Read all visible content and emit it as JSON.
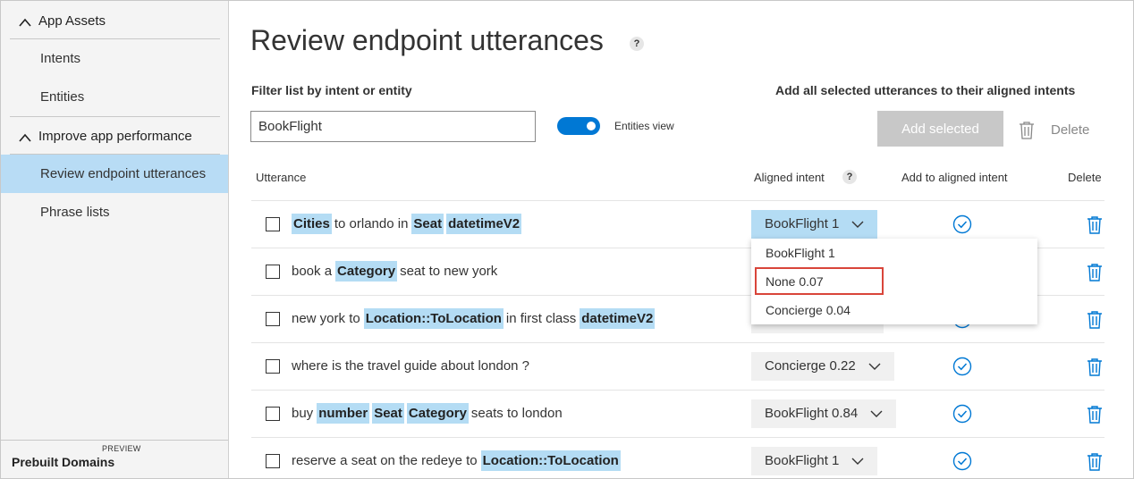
{
  "sidebar": {
    "app_assets": "App Assets",
    "intents": "Intents",
    "entities": "Entities",
    "improve": "Improve app performance",
    "review": "Review endpoint utterances",
    "phrase_lists": "Phrase lists",
    "prebuilt": "Prebuilt Domains",
    "preview_badge": "PREVIEW"
  },
  "main": {
    "title": "Review endpoint utterances",
    "help_glyph": "?",
    "filter_label": "Filter list by intent or entity",
    "filter_value": "BookFlight",
    "entities_view": "Entities view",
    "entities_view_on": true,
    "add_all_label": "Add all selected utterances to their aligned intents",
    "add_selected": "Add selected",
    "delete": "Delete"
  },
  "table": {
    "headers": {
      "utterance": "Utterance",
      "aligned_intent": "Aligned intent",
      "add_to_intent": "Add to aligned intent",
      "delete": "Delete"
    },
    "rows": [
      {
        "tokens": [
          {
            "t": "Cities",
            "e": true
          },
          {
            "t": "to orlando in",
            "e": false
          },
          {
            "t": "Seat",
            "e": true
          },
          {
            "t": "datetimeV2",
            "e": true
          }
        ],
        "intent": "BookFlight 1"
      },
      {
        "tokens": [
          {
            "t": "book a",
            "e": false
          },
          {
            "t": "Category",
            "e": true
          },
          {
            "t": "seat to new york",
            "e": false
          }
        ],
        "intent": ""
      },
      {
        "tokens": [
          {
            "t": "new york to",
            "e": false
          },
          {
            "t": "Location::ToLocation",
            "e": true
          },
          {
            "t": "in first class",
            "e": false
          },
          {
            "t": "datetimeV2",
            "e": true
          }
        ],
        "intent": ""
      },
      {
        "tokens": [
          {
            "t": "where is the travel guide about london ?",
            "e": false
          }
        ],
        "intent": "Concierge 0.22"
      },
      {
        "tokens": [
          {
            "t": "buy",
            "e": false
          },
          {
            "t": "number",
            "e": true
          },
          {
            "t": "Seat",
            "e": true
          },
          {
            "t": "Category",
            "e": true
          },
          {
            "t": "seats to london",
            "e": false
          }
        ],
        "intent": "BookFlight 0.84"
      },
      {
        "tokens": [
          {
            "t": "reserve a seat on the redeye to",
            "e": false
          },
          {
            "t": "Location::ToLocation",
            "e": true
          }
        ],
        "intent": "BookFlight 1"
      }
    ]
  },
  "dropdown": {
    "options": [
      "BookFlight 1",
      "None 0.07",
      "Concierge 0.04"
    ],
    "highlighted_index": 1
  },
  "colors": {
    "accent": "#0078d4",
    "entity_bg": "#b4dcf4",
    "active_nav": "#b8dcf5",
    "highlight_border": "#d9453a"
  }
}
